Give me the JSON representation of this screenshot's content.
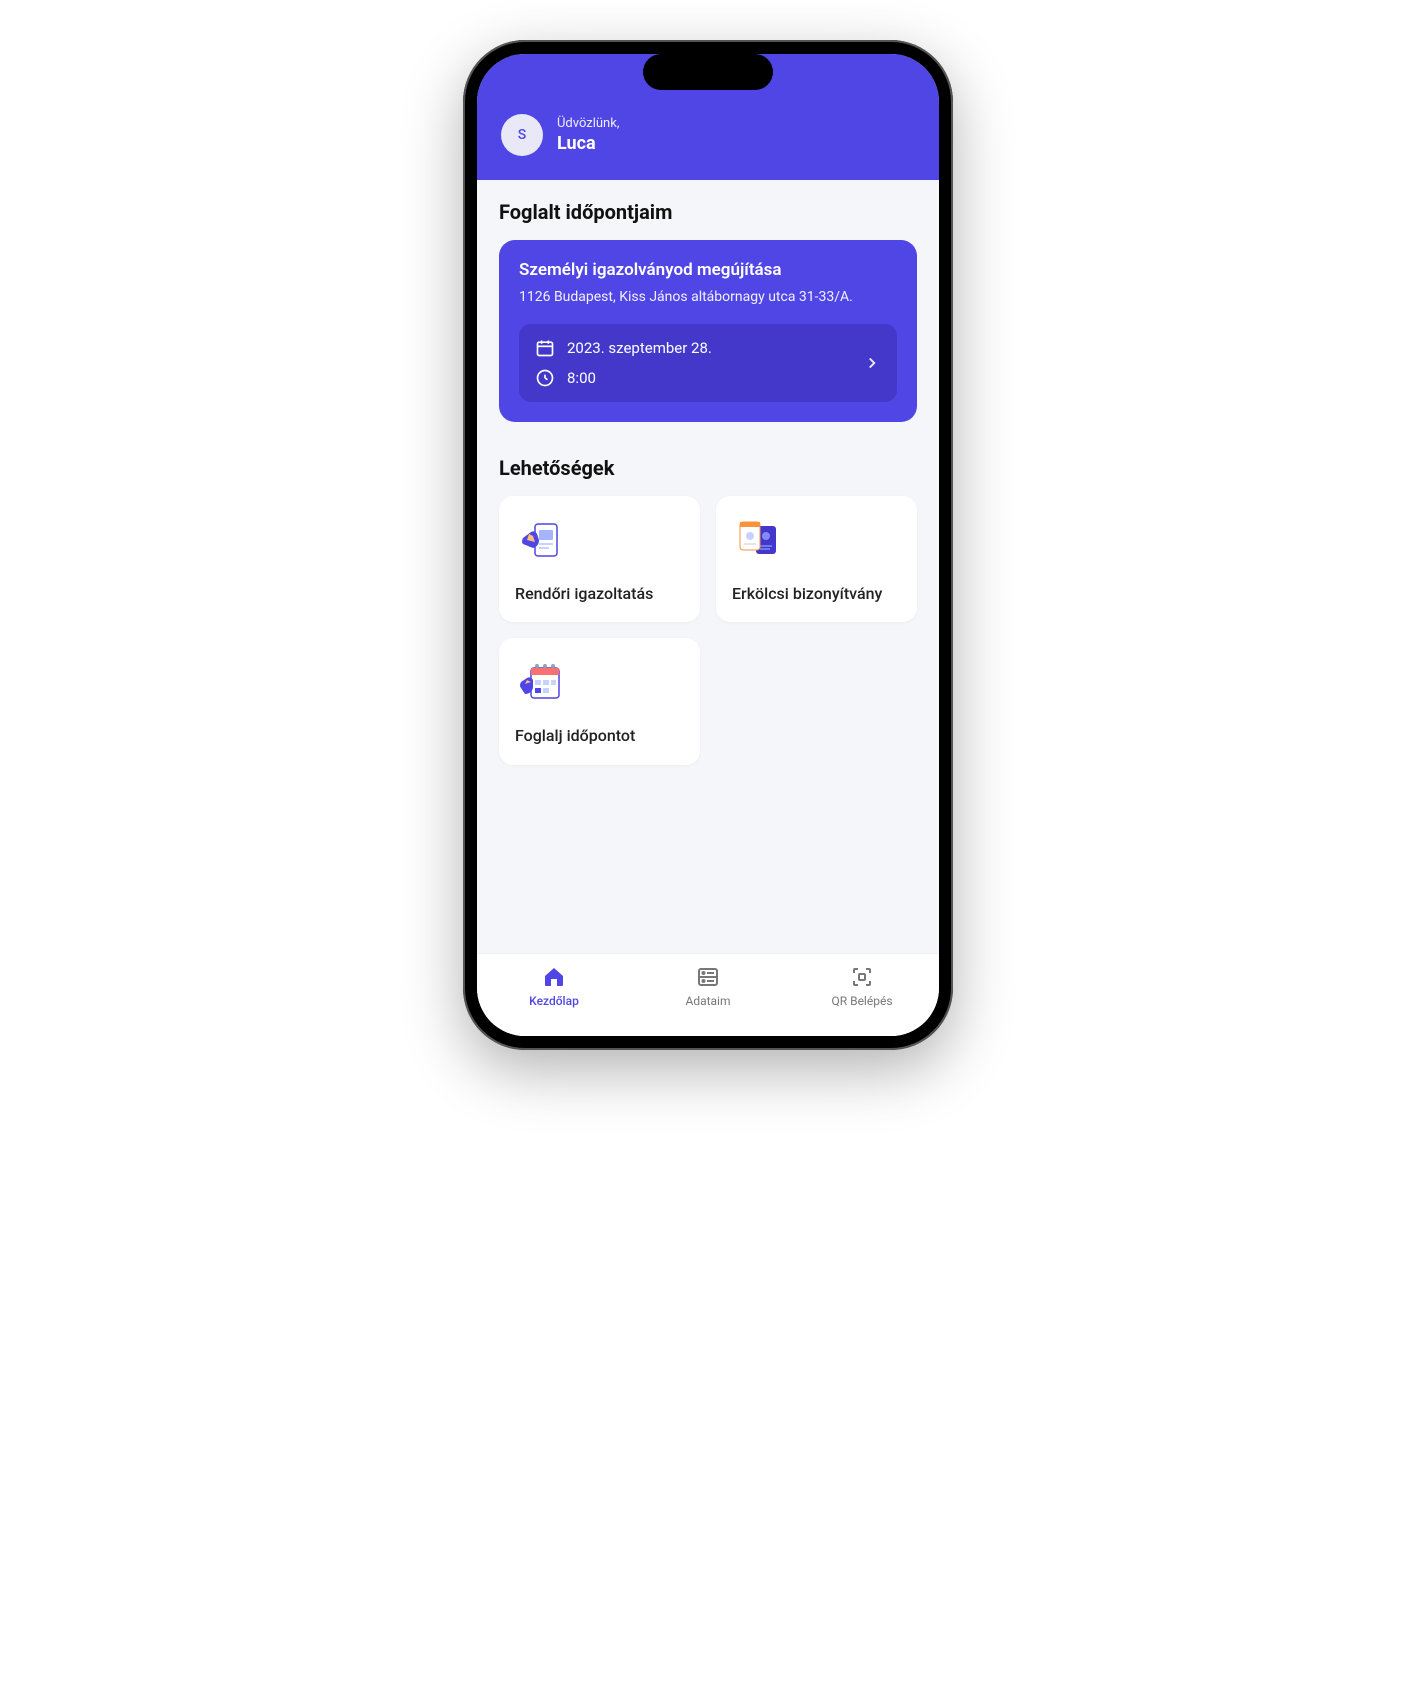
{
  "header": {
    "avatar_letter": "S",
    "greeting_small": "Üdvözlünk,",
    "greeting_name": "Luca"
  },
  "appointments": {
    "section_title": "Foglalt időpontjaim",
    "card": {
      "title": "Személyi igazolványod megújítása",
      "address": "1126 Budapest, Kiss János altábornagy utca 31-33/A.",
      "date": "2023. szeptember 28.",
      "time": "8:00"
    }
  },
  "options": {
    "section_title": "Lehetőségek",
    "items": [
      {
        "label": "Rendőri igazoltatás",
        "icon": "police-id-icon"
      },
      {
        "label": "Erkölcsi bizonyítvány",
        "icon": "certificate-icon"
      },
      {
        "label": "Foglalj időpontot",
        "icon": "calendar-booking-icon"
      }
    ]
  },
  "tabbar": {
    "items": [
      {
        "label": "Kezdőlap",
        "icon": "home-icon",
        "active": true
      },
      {
        "label": "Adataim",
        "icon": "data-list-icon",
        "active": false
      },
      {
        "label": "QR Belépés",
        "icon": "qr-icon",
        "active": false
      }
    ]
  },
  "colors": {
    "primary": "#4f46e5",
    "primary_dark": "#4338ca",
    "bg": "#f5f6f9"
  }
}
